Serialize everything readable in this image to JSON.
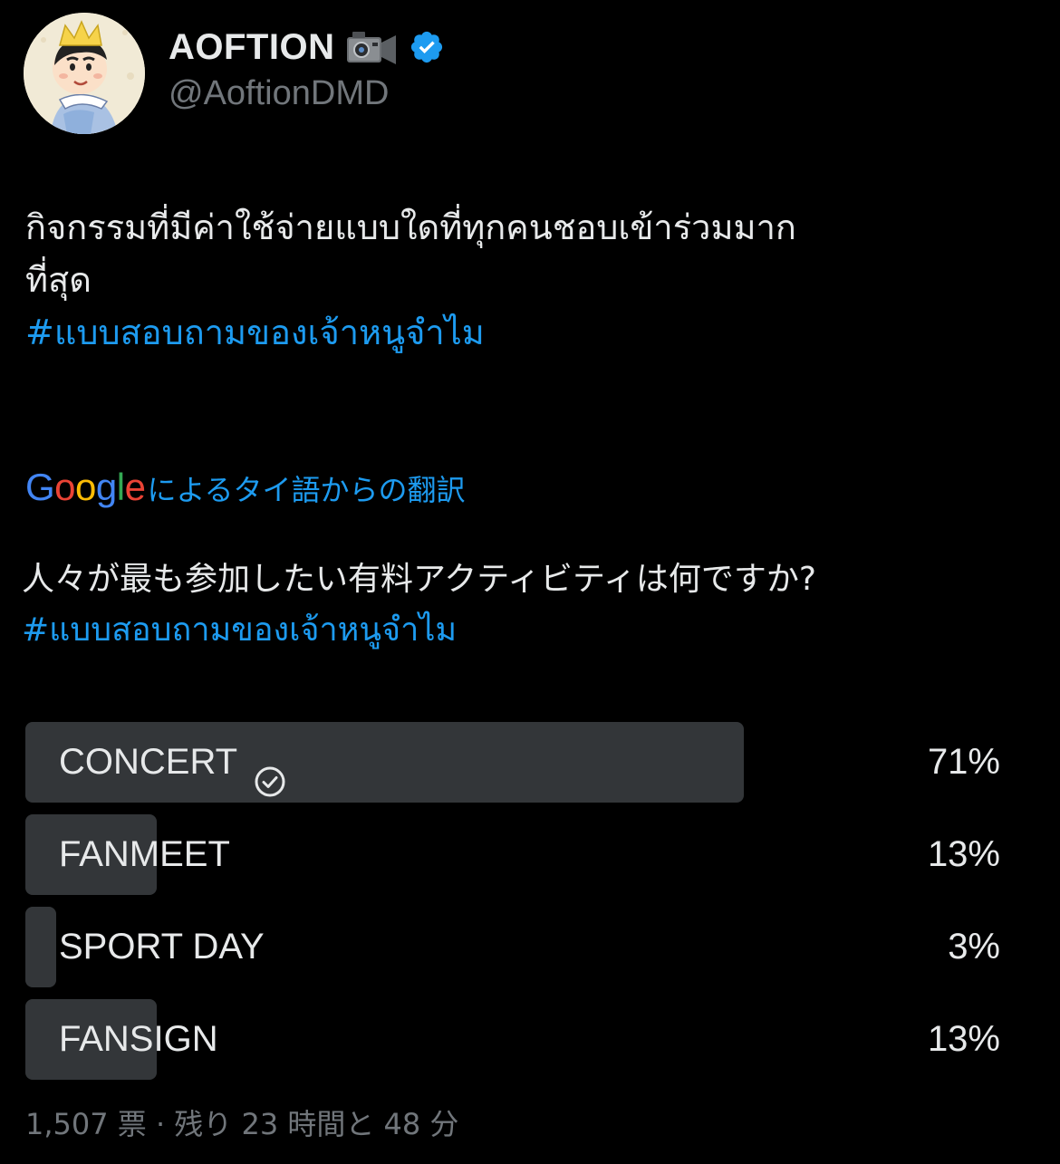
{
  "user": {
    "display_name": "AOFTION",
    "handle": "@AoftionDMD",
    "name_emoji": "video-camera-icon",
    "verified": true
  },
  "tweet": {
    "line1": "กิจกรรมที่มีค่าใช้จ่ายแบบใดที่ทุกคนชอบเข้าร่วมมาก",
    "line2": "ที่สุด",
    "hashtag": "#แบบสอบถามของเจ้าหนูจำไม"
  },
  "translation": {
    "logo": "Google",
    "label": "によるタイ語からの翻訳",
    "text": "人々が最も参加したい有料アクティビティは何ですか?",
    "hashtag": "#แบบสอบถามของเจ้าหนูจำไม"
  },
  "poll": {
    "options": [
      {
        "label": "CONCERT",
        "percent": "71%",
        "value": 71,
        "winner": true
      },
      {
        "label": "FANMEET",
        "percent": "13%",
        "value": 13,
        "winner": false
      },
      {
        "label": "SPORT DAY",
        "percent": "3%",
        "value": 3,
        "winner": false
      },
      {
        "label": "FANSIGN",
        "percent": "13%",
        "value": 13,
        "winner": false
      }
    ],
    "footer": "1,507 票 · 残り 23 時間と 48 分"
  },
  "colors": {
    "background": "#000000",
    "text": "#e7e9ea",
    "secondary": "#71767b",
    "link": "#1d9bf0",
    "poll_bar": "#333639",
    "verified": "#1d9bf0"
  }
}
